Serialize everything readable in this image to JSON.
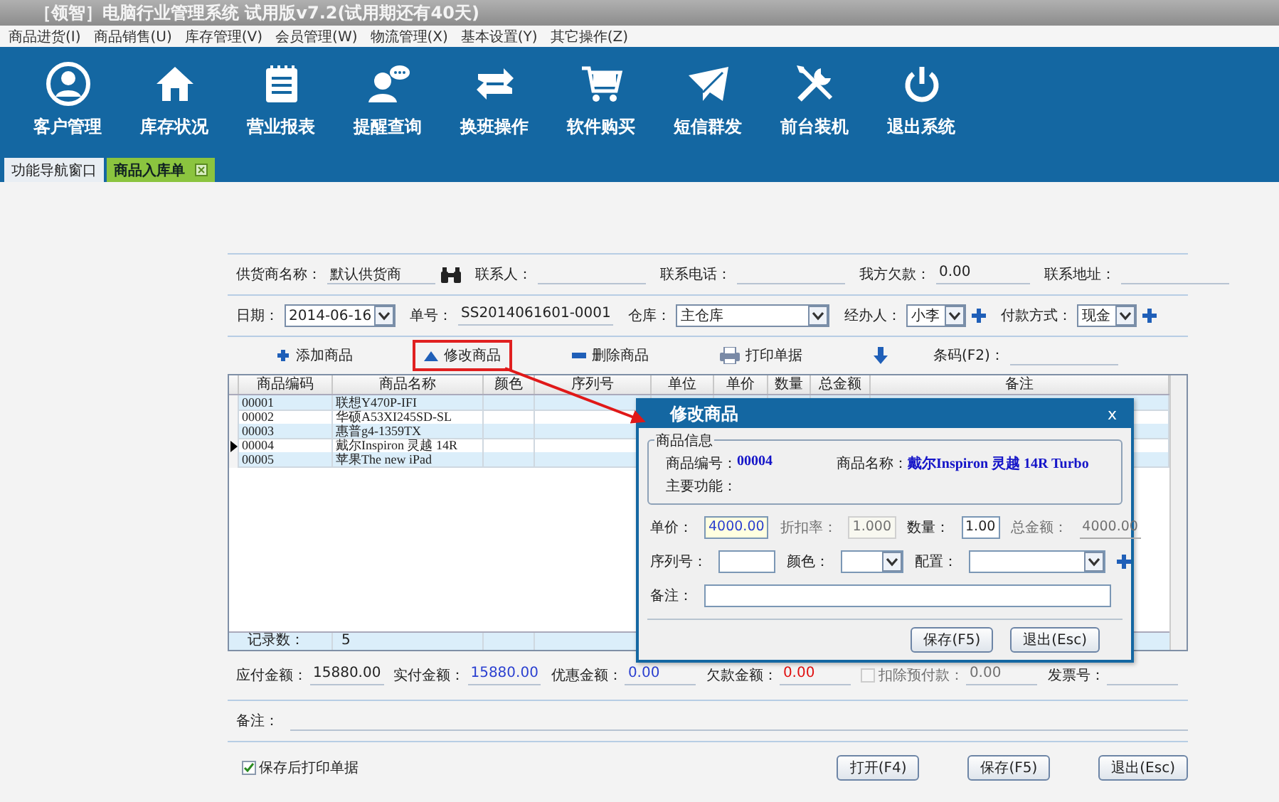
{
  "window": {
    "title": "［领智］电脑行业管理系统 试用版v7.2(试用期还有40天)"
  },
  "menu": [
    "商品进货(I)",
    "商品销售(U)",
    "库存管理(V)",
    "会员管理(W)",
    "物流管理(X)",
    "基本设置(Y)",
    "其它操作(Z)"
  ],
  "toolbar": [
    {
      "label": "客户管理",
      "kind": "user"
    },
    {
      "label": "库存状况",
      "kind": "house"
    },
    {
      "label": "营业报表",
      "kind": "notepad"
    },
    {
      "label": "提醒查询",
      "kind": "chat"
    },
    {
      "label": "换班操作",
      "kind": "swap"
    },
    {
      "label": "软件购买",
      "kind": "cart"
    },
    {
      "label": "短信群发",
      "kind": "mail"
    },
    {
      "label": "前台装机",
      "kind": "tools"
    },
    {
      "label": "退出系统",
      "kind": "power"
    }
  ],
  "tabs": [
    {
      "label": "功能导航窗口",
      "selected": false,
      "closable": false
    },
    {
      "label": "商品入库单",
      "selected": true,
      "closable": true
    }
  ],
  "header_rows": [
    [
      {
        "label": "供货商名称：",
        "value": "默认供货商",
        "kind": "text",
        "lookup": true
      },
      {
        "label": "联系人：",
        "kind": "text"
      },
      {
        "label": "联系电话：",
        "kind": "text"
      },
      {
        "label": "我方欠款：",
        "value": "0.00",
        "kind": "text"
      },
      {
        "label": "联系地址：",
        "kind": "text"
      }
    ],
    [
      {
        "label": "日期：",
        "value": "2014-06-16",
        "kind": "dropdown",
        "add": false
      },
      {
        "label": "单号：",
        "value": "SS2014061601-0001",
        "kind": "text"
      },
      {
        "label": "仓库：",
        "value": "主仓库",
        "kind": "dropdown",
        "add": false
      },
      {
        "label": "经办人：",
        "value": "小李",
        "kind": "dropdown",
        "add": true
      },
      {
        "label": "付款方式：",
        "value": "现金",
        "kind": "dropdown",
        "add": true
      }
    ]
  ],
  "actions": [
    {
      "label": "添加商品",
      "kind": "plus",
      "highlighted": false
    },
    {
      "label": "修改商品",
      "kind": "up",
      "highlighted": true
    },
    {
      "label": "删除商品",
      "kind": "minus",
      "highlighted": false
    },
    {
      "label": "打印单据",
      "kind": "printer",
      "highlighted": false
    },
    {
      "kind": "down",
      "highlighted": false
    }
  ],
  "barcode": {
    "label": "条码(F2)："
  },
  "table": {
    "columns": [
      "商品编码",
      "商品名称",
      "颜色",
      "序列号",
      "单位",
      "单价",
      "数量",
      "总金额",
      "备注"
    ],
    "rows": [
      {
        "code": "00001",
        "name": "联想Y470P-IFI",
        "selected": false
      },
      {
        "code": "00002",
        "name": "华硕A53XI245SD-SL",
        "selected": false
      },
      {
        "code": "00003",
        "name": "惠普g4-1359TX",
        "selected": false
      },
      {
        "code": "00004",
        "name": "戴尔Inspiron 灵越 14R",
        "selected": true
      },
      {
        "code": "00005",
        "name": "苹果The new iPad",
        "selected": false
      }
    ],
    "footer": {
      "label": "记录数：",
      "value": "5"
    }
  },
  "totals": [
    {
      "label": "应付金额：",
      "value": "15880.00",
      "kind": "plain"
    },
    {
      "label": "实付金额：",
      "value": "15880.00",
      "kind": "blue"
    },
    {
      "label": "优惠金额：",
      "value": "0.00",
      "kind": "blue"
    },
    {
      "label": "欠款金额：",
      "value": "0.00",
      "kind": "red"
    },
    {
      "label": "扣除预付款：",
      "value": "0.00",
      "kind": "check",
      "checked": false,
      "disabled": true
    },
    {
      "label": "发票号：",
      "kind": "plain"
    }
  ],
  "notes": {
    "label": "备注："
  },
  "print_after_save": {
    "label": "保存后打印单据",
    "checked": true
  },
  "buttons": [
    "打开(F4)",
    "保存(F5)",
    "退出(Esc)"
  ],
  "dialog": {
    "title": "修改商品",
    "close": "x",
    "group": "商品信息",
    "info": [
      {
        "label": "商品编号：",
        "value": "00004"
      },
      {
        "label": "商品名称：",
        "value": "戴尔Inspiron 灵越 14R Turbo"
      },
      {
        "label": "主要功能："
      }
    ],
    "rows": [
      [
        {
          "label": "单价：",
          "value": "4000.00",
          "kind": "text",
          "disabled": false,
          "focused": true
        },
        {
          "label": "折扣率：",
          "value": "1.000",
          "kind": "text",
          "disabled": true,
          "focused": false
        },
        {
          "label": "数量：",
          "value": "1.00",
          "kind": "text",
          "disabled": false,
          "focused": false
        },
        {
          "label": "总金额：",
          "value": "4000.00",
          "kind": "text",
          "disabled": true,
          "focused": false
        }
      ],
      [
        {
          "label": "序列号：",
          "kind": "text"
        },
        {
          "label": "颜色：",
          "kind": "dropdown",
          "add": false
        },
        {
          "label": "配置：",
          "kind": "dropdown",
          "add": true
        }
      ],
      [
        {
          "label": "备注：",
          "kind": "wide"
        }
      ]
    ],
    "buttons": [
      "保存(F5)",
      "退出(Esc)"
    ]
  }
}
